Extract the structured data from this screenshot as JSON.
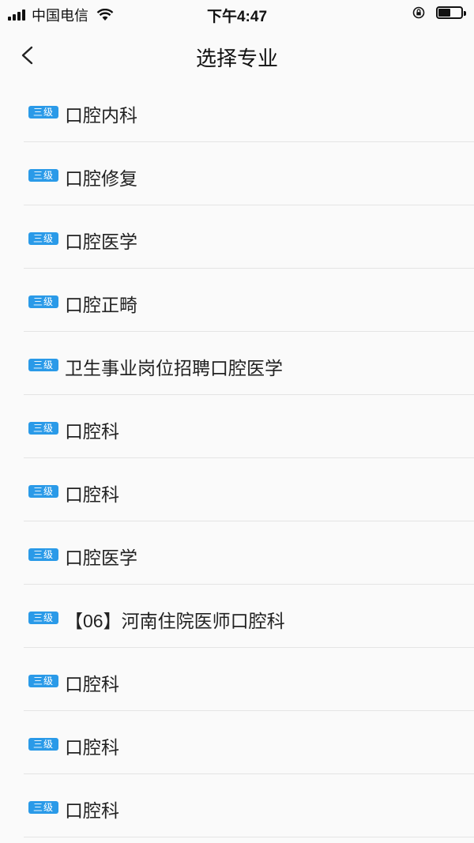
{
  "status_bar": {
    "carrier": "中国电信",
    "time": "下午4:47",
    "battery_level": 0.55
  },
  "nav": {
    "title": "选择专业"
  },
  "majors": [
    {
      "badge": "三级",
      "label": "口腔内科"
    },
    {
      "badge": "三级",
      "label": "口腔修复"
    },
    {
      "badge": "三级",
      "label": "口腔医学"
    },
    {
      "badge": "三级",
      "label": "口腔正畸"
    },
    {
      "badge": "三级",
      "label": "卫生事业岗位招聘口腔医学"
    },
    {
      "badge": "三级",
      "label": "口腔科"
    },
    {
      "badge": "三级",
      "label": "口腔科"
    },
    {
      "badge": "三级",
      "label": "口腔医学"
    },
    {
      "badge": "三级",
      "label": "【06】河南住院医师口腔科"
    },
    {
      "badge": "三级",
      "label": "口腔科"
    },
    {
      "badge": "三级",
      "label": "口腔科"
    },
    {
      "badge": "三级",
      "label": "口腔科"
    }
  ],
  "colors": {
    "badge": "#2a9ae8",
    "background": "#fafafa",
    "divider": "#e4e4e4"
  }
}
